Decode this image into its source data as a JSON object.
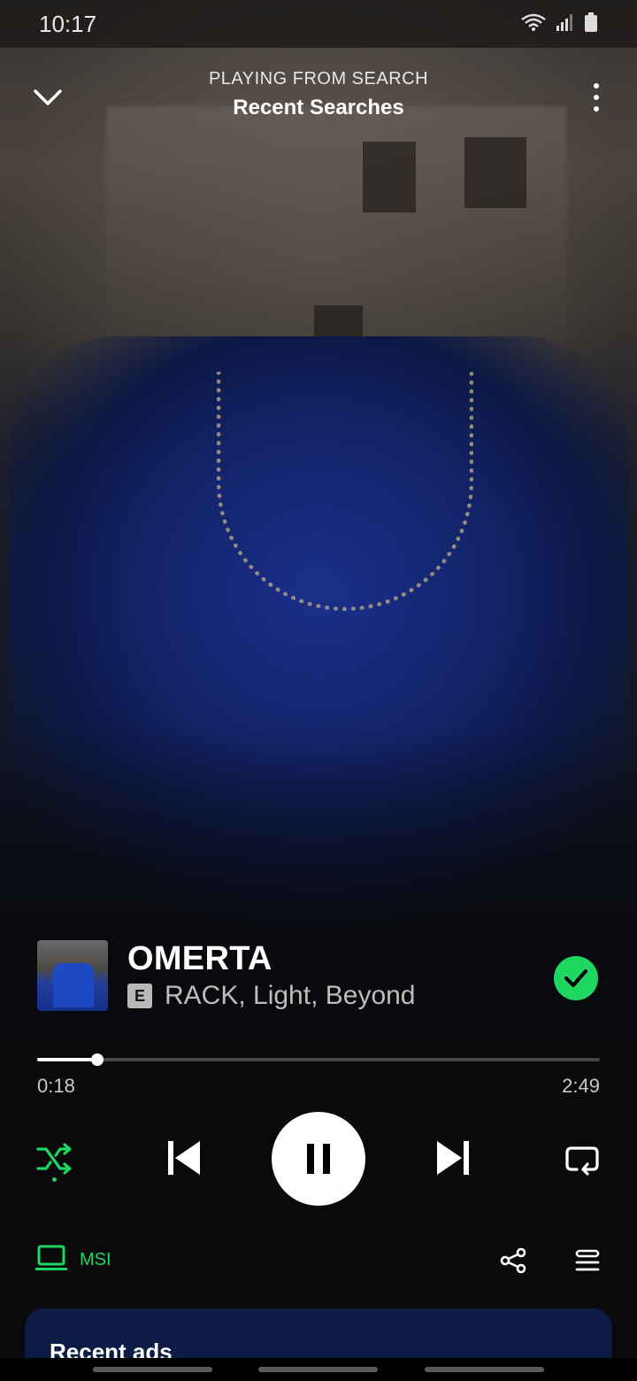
{
  "status_bar": {
    "time": "10:17"
  },
  "header": {
    "context_label": "PLAYING FROM SEARCH",
    "context_name": "Recent Searches"
  },
  "track": {
    "title": "OMERTA",
    "explicit_badge": "E",
    "artists": "RACK, Light, Beyond",
    "liked": true
  },
  "playback": {
    "elapsed": "0:18",
    "duration": "2:49",
    "progress_fraction": 0.107,
    "shuffle_on": true,
    "state": "playing"
  },
  "device": {
    "name": "MSI"
  },
  "card": {
    "title": "Recent ads"
  },
  "colors": {
    "accent": "#1ed760",
    "background": "#0a0a0c",
    "card_background": "#0c1c44"
  },
  "icons": {
    "collapse": "chevron-down-icon",
    "more": "more-vertical-icon",
    "liked": "check-circle-icon",
    "shuffle": "shuffle-icon",
    "previous": "skip-previous-icon",
    "play_pause": "pause-icon",
    "next": "skip-next-icon",
    "repeat": "repeat-icon",
    "device": "laptop-icon",
    "share": "share-icon",
    "queue": "queue-icon"
  }
}
